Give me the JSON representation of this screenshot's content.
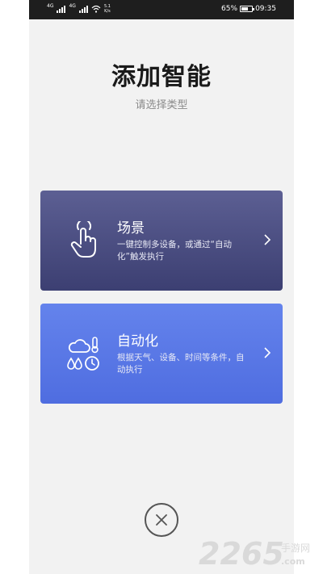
{
  "status_bar": {
    "signal1_label": "4G",
    "signal2_label": "4G",
    "speed_value": "5.1",
    "speed_unit": "K/s",
    "battery": "65%",
    "battery_level": 0.65,
    "time": "09:35"
  },
  "header": {
    "title": "添加智能",
    "subtitle": "请选择类型"
  },
  "cards": [
    {
      "title": "场景",
      "description": "一键控制多设备，或通过“自动化”触发执行",
      "icon": "touch-hand-icon"
    },
    {
      "title": "自动化",
      "description": "根据天气、设备、时间等条件，自动执行",
      "icon": "weather-clock-icon"
    }
  ],
  "close_icon": "close-icon",
  "watermark": {
    "number": "2265",
    "suffix": "手游网",
    "domain": ".com",
    "color": "#d9d9d9"
  },
  "colors": {
    "scene_card": "#4a4d80",
    "auto_card": "#5b79e8",
    "background": "#f2f2f2"
  }
}
